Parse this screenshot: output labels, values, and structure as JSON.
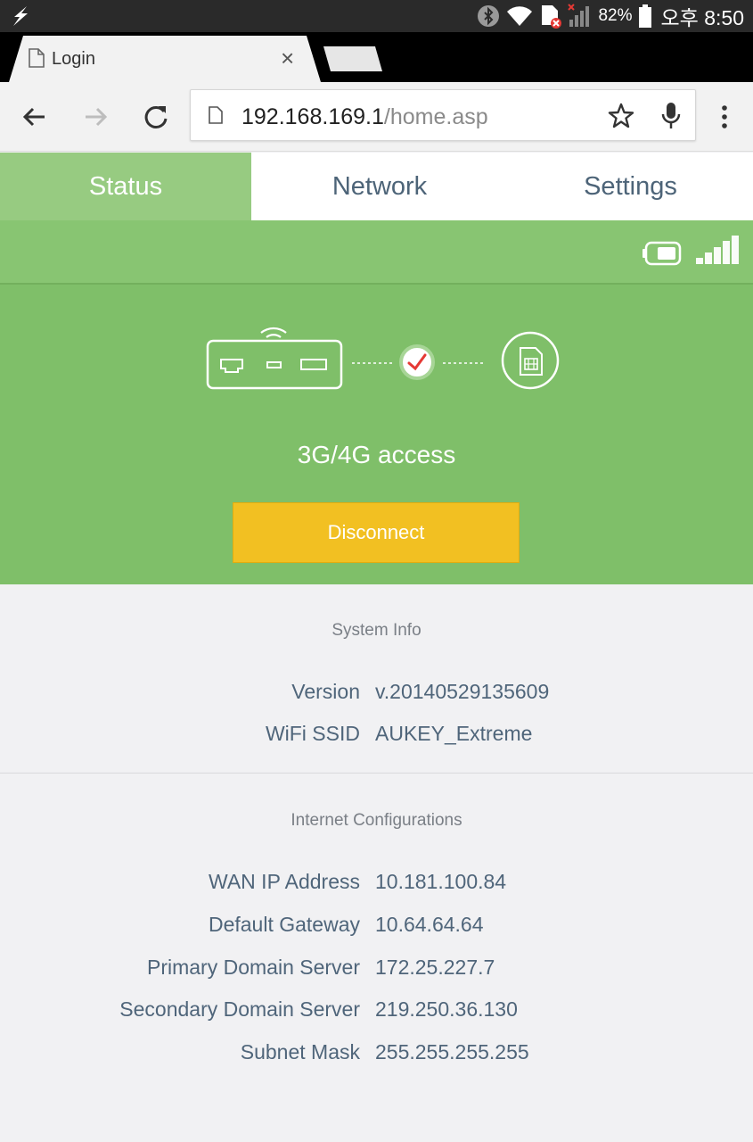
{
  "status_bar": {
    "battery_percent": "82%",
    "time": "오후 8:50"
  },
  "browser": {
    "tab_title": "Login",
    "url_host": "192.168.169.1",
    "url_path": "/home.asp"
  },
  "nav_tabs": [
    {
      "label": "Status",
      "active": true
    },
    {
      "label": "Network",
      "active": false
    },
    {
      "label": "Settings",
      "active": false
    }
  ],
  "connection": {
    "access_label": "3G/4G access",
    "disconnect_label": "Disconnect",
    "icons": [
      "battery-icon",
      "signal-strength-icon",
      "router-icon",
      "wifi-icon",
      "check-icon",
      "sim-card-icon"
    ]
  },
  "system_info": {
    "title": "System Info",
    "rows": [
      {
        "label": "Version",
        "value": "v.20140529135609"
      },
      {
        "label": "WiFi SSID",
        "value": "AUKEY_Extreme"
      }
    ]
  },
  "internet_config": {
    "title": "Internet Configurations",
    "rows": [
      {
        "label": "WAN IP Address",
        "value": "10.181.100.84"
      },
      {
        "label": "Default Gateway",
        "value": "10.64.64.64"
      },
      {
        "label": "Primary Domain Server",
        "value": "172.25.227.7"
      },
      {
        "label": "Secondary Domain Server",
        "value": "219.250.36.130"
      },
      {
        "label": "Subnet Mask",
        "value": "255.255.255.255"
      }
    ]
  },
  "colors": {
    "green": "#7fbf69",
    "active_tab": "#97cb81",
    "button": "#f2c022",
    "text": "#4f657a"
  }
}
